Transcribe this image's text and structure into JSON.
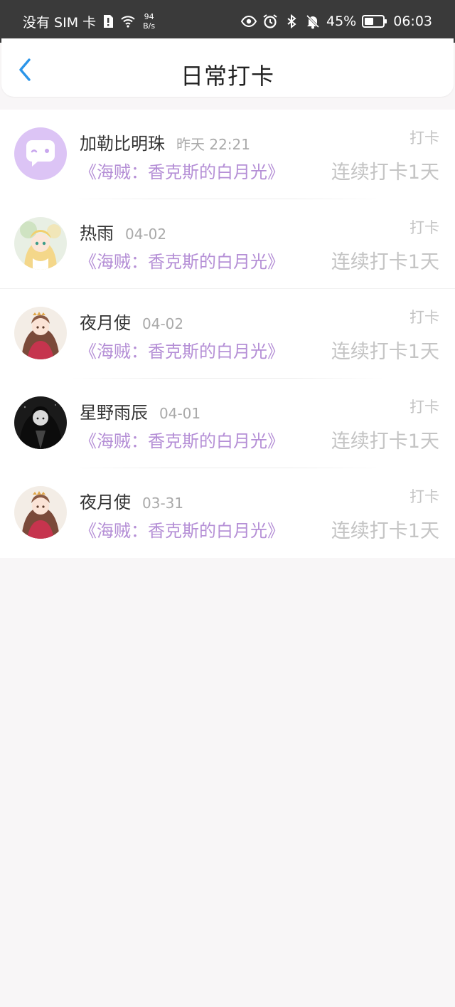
{
  "status_bar": {
    "carrier": "没有 SIM 卡",
    "net_speed_value": "94",
    "net_speed_unit": "B/s",
    "battery": "45%",
    "time": "06:03"
  },
  "header": {
    "title": "日常打卡"
  },
  "entries": [
    {
      "name": "加勒比明珠",
      "time": "昨天 22:21",
      "book": "《海贼：香克斯的白月光》",
      "action": "打卡",
      "streak": "连续打卡1天"
    },
    {
      "name": "热雨",
      "time": "04-02",
      "book": "《海贼：香克斯的白月光》",
      "action": "打卡",
      "streak": "连续打卡1天"
    },
    {
      "name": "夜月使",
      "time": "04-02",
      "book": "《海贼：香克斯的白月光》",
      "action": "打卡",
      "streak": "连续打卡1天"
    },
    {
      "name": "星野雨辰",
      "time": "04-01",
      "book": "《海贼：香克斯的白月光》",
      "action": "打卡",
      "streak": "连续打卡1天"
    },
    {
      "name": "夜月使",
      "time": "03-31",
      "book": "《海贼：香克斯的白月光》",
      "action": "打卡",
      "streak": "连续打卡1天"
    }
  ],
  "colors": {
    "accent_blue": "#2b95e9",
    "book_purple": "#b58fd6",
    "avatar_default": "#dcc4f5"
  }
}
